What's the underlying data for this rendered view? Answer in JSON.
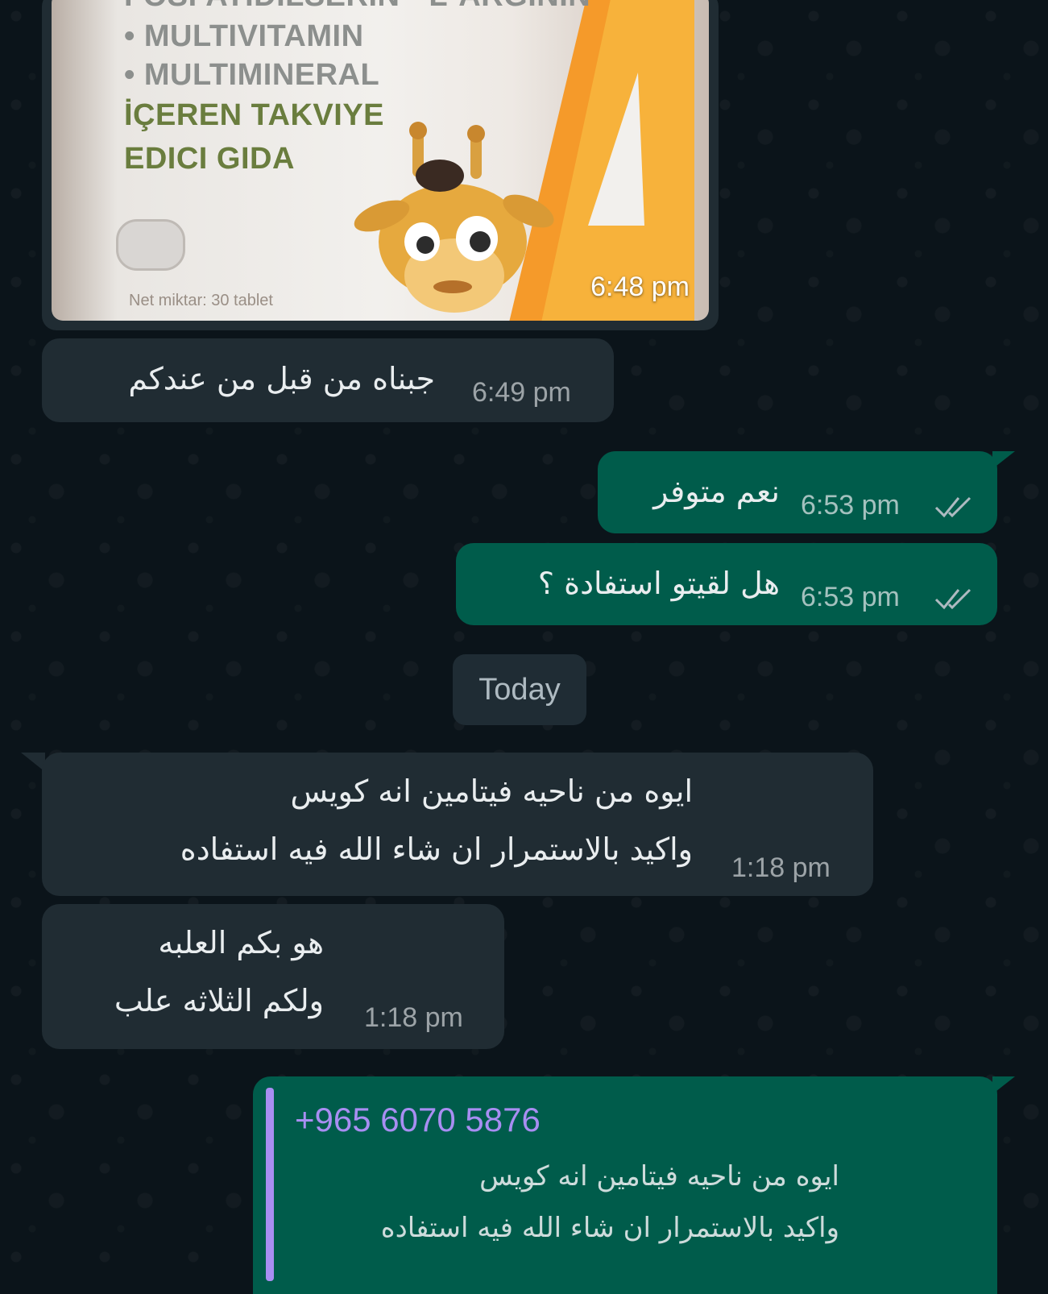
{
  "image_message": {
    "time": "6:48 pm",
    "bottle_lines": [
      "FOSFATIDILSERIN • L-ARGININ",
      "• MULTIVITAMIN",
      "• MULTIMINERAL",
      "İÇEREN TAKVIYE",
      "EDICI GIDA"
    ],
    "net_amount": "Net miktar: 30 tablet"
  },
  "messages": [
    {
      "direction": "incoming",
      "text": "جبناه من قبل من عندكم",
      "time": "6:49 pm"
    },
    {
      "direction": "outgoing",
      "text": "نعم متوفر",
      "time": "6:53 pm",
      "status": "read"
    },
    {
      "direction": "outgoing",
      "text": "هل لقيتو استفادة ؟",
      "time": "6:53 pm",
      "status": "read"
    },
    {
      "direction": "incoming",
      "text": "ايوه من ناحيه فيتامين انه كويس\nواكيد بالاستمرار ان شاء الله فيه استفاده",
      "time": "1:18 pm"
    },
    {
      "direction": "incoming",
      "text": "هو بكم العلبه\nولكم الثلاثه علب",
      "time": "1:18 pm"
    }
  ],
  "date_divider": "Today",
  "reply": {
    "quoted_author": "+965 6070 5876",
    "quoted_text": "ايوه من ناحيه فيتامين انه كويس\nواكيد بالاستمرار ان شاء الله فيه استفاده"
  },
  "colors": {
    "background": "#0b141a",
    "incoming_bubble": "#202c33",
    "outgoing_bubble": "#005c4b",
    "quote_accent": "#a88ef2",
    "read_ticks": "#aebac1"
  }
}
